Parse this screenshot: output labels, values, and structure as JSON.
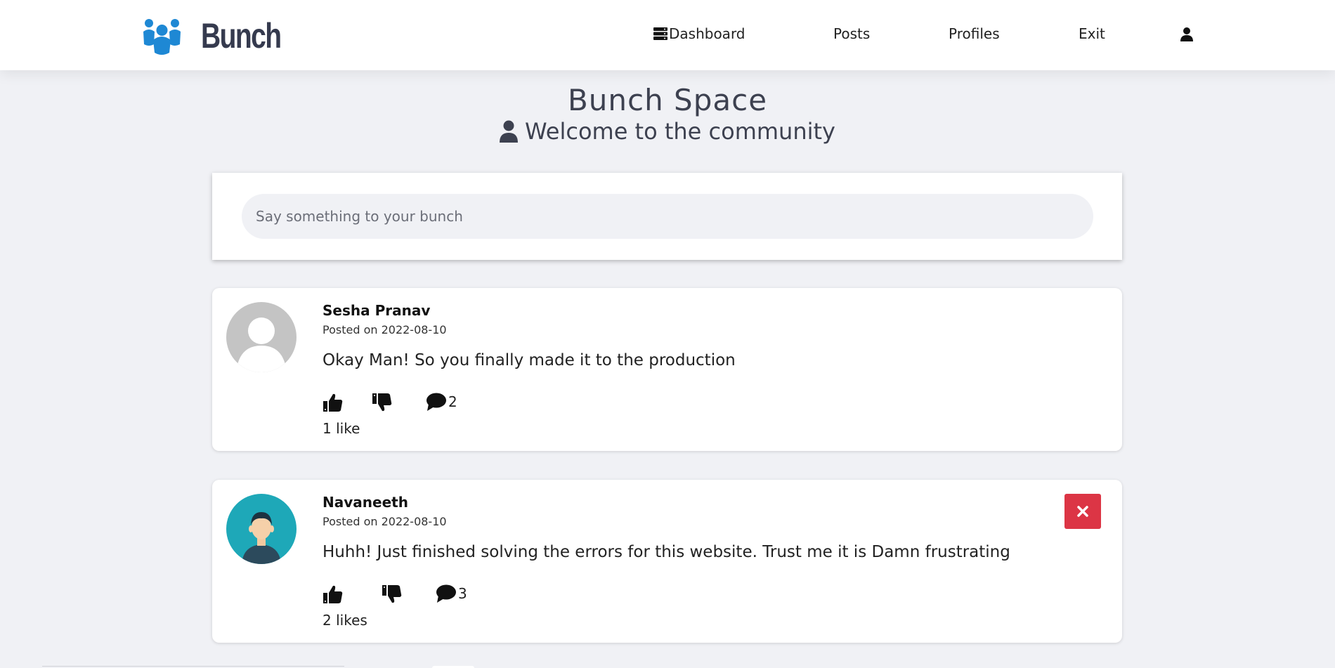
{
  "brand": {
    "name": "Bunch",
    "accent": "#1e88d4",
    "text_color": "#353a4e"
  },
  "nav": {
    "dashboard": "Dashboard",
    "posts": "Posts",
    "profiles": "Profiles",
    "exit": "Exit",
    "user_icon": "user-icon"
  },
  "header": {
    "title": "Bunch Space",
    "subtitle": "Welcome to the community"
  },
  "composer": {
    "placeholder": "Say something to your bunch",
    "value": ""
  },
  "posts": [
    {
      "author": "Sesha Pranav",
      "date": "Posted on 2022-08-10",
      "text": "Okay Man! So you finally made it to the production",
      "comments": "2",
      "likes": "1 like",
      "avatar": "default-avatar"
    },
    {
      "author": "Navaneeth",
      "date": "Posted on 2022-08-10",
      "text": "Huhh! Just finished solving the errors for this website. Trust me it is Damn frustrating",
      "comments": "3",
      "likes": "2 likes",
      "avatar": "user-avatar",
      "deletable": true
    }
  ],
  "colors": {
    "background": "#f0f1f5",
    "delete": "#dc3545",
    "avatar_teal": "#1ea8b8"
  }
}
